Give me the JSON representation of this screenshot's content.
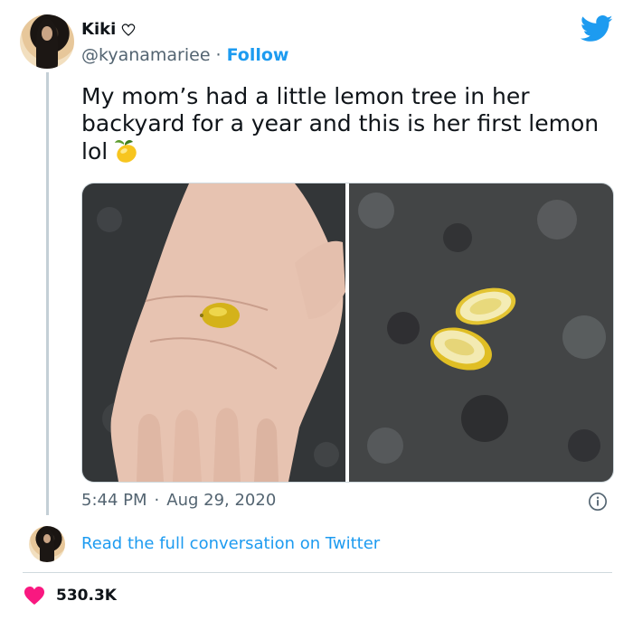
{
  "tweet": {
    "display_name": "Kiki",
    "name_badge_icon": "heart-outline-icon",
    "handle": "@kyanamariee",
    "separator": "·",
    "follow_label": "Follow",
    "text": "My mom’s had a little lemon tree in her backyard for a year and this is her first lemon lol",
    "emoji_icon": "lemon-emoji",
    "time": "5:44 PM",
    "date": "Aug 29, 2020",
    "media": [
      {
        "icon": "photo-lemon-in-palm"
      },
      {
        "icon": "photo-lemon-halves-on-granite"
      }
    ]
  },
  "conversation": {
    "link_label": "Read the full conversation on Twitter"
  },
  "stats": {
    "likes": "530.3K",
    "likes_icon": "heart-filled-icon"
  },
  "colors": {
    "accent": "#1d9bf0",
    "like_heart": "#f91880",
    "text_primary": "#0f1419",
    "text_secondary": "#536471",
    "divider": "#cfd9de"
  }
}
